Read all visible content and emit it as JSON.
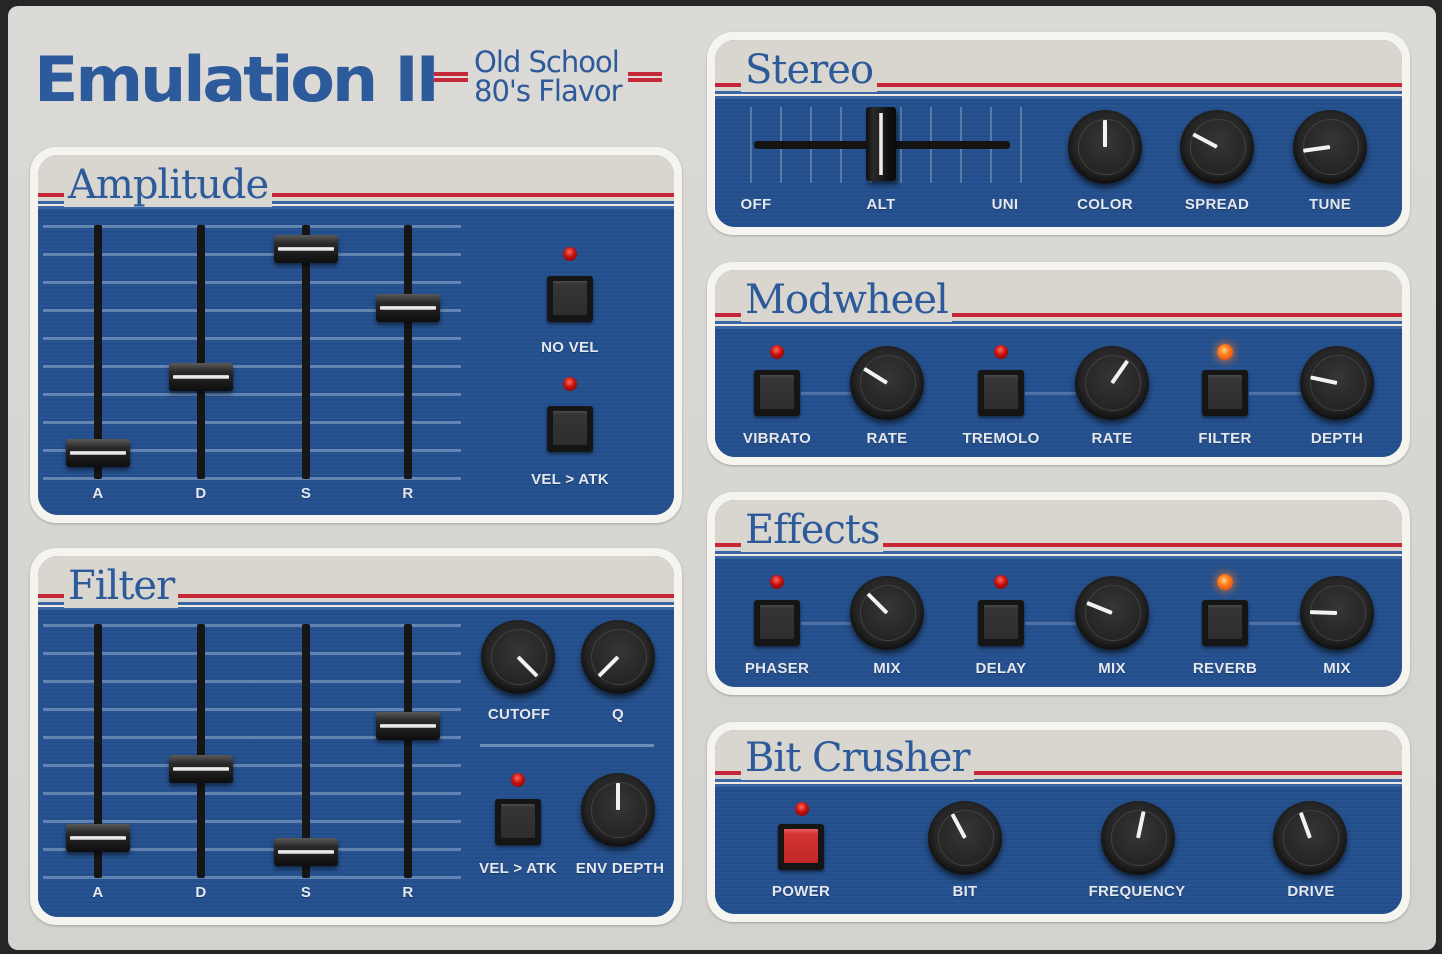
{
  "app": {
    "title": "Emulation II",
    "tagline_line1": "Old School",
    "tagline_line2": "80's Flavor"
  },
  "colors": {
    "panel_blue": "#24508e",
    "accent_red": "#c6283a",
    "title_blue": "#2c5a9a",
    "led_off": "#c2100c",
    "led_on": "#ff7a1a"
  },
  "amplitude": {
    "title": "Amplitude",
    "sliders": [
      {
        "label": "A",
        "value": 0.06
      },
      {
        "label": "D",
        "value": 0.39
      },
      {
        "label": "S",
        "value": 0.95
      },
      {
        "label": "R",
        "value": 0.69
      }
    ],
    "buttons": [
      {
        "label": "NO VEL",
        "led_on": false
      },
      {
        "label": "VEL > ATK",
        "led_on": false
      }
    ]
  },
  "filter": {
    "title": "Filter",
    "sliders": [
      {
        "label": "A",
        "value": 0.12
      },
      {
        "label": "D",
        "value": 0.42
      },
      {
        "label": "S",
        "value": 0.06
      },
      {
        "label": "R",
        "value": 0.61
      }
    ],
    "knobs": [
      {
        "label": "CUTOFF",
        "angle": 135
      },
      {
        "label": "Q",
        "angle": -135
      },
      {
        "label": "ENV DEPTH",
        "angle": 0
      }
    ],
    "button": {
      "label": "VEL > ATK",
      "led_on": false
    }
  },
  "stereo": {
    "title": "Stereo",
    "mode_switch": {
      "options": [
        "OFF",
        "ALT",
        "UNI"
      ],
      "selected": "ALT"
    },
    "knobs": [
      {
        "label": "COLOR",
        "angle": 0
      },
      {
        "label": "SPREAD",
        "angle": -62
      },
      {
        "label": "TUNE",
        "angle": -98
      }
    ]
  },
  "modwheel": {
    "title": "Modwheel",
    "items": [
      {
        "type": "button",
        "label": "VIBRATO",
        "led_on": false
      },
      {
        "type": "knob",
        "label": "RATE",
        "angle": -58
      },
      {
        "type": "button",
        "label": "TREMOLO",
        "led_on": false
      },
      {
        "type": "knob",
        "label": "RATE",
        "angle": 35
      },
      {
        "type": "button",
        "label": "FILTER",
        "led_on": true
      },
      {
        "type": "knob",
        "label": "DEPTH",
        "angle": -78
      }
    ]
  },
  "effects": {
    "title": "Effects",
    "items": [
      {
        "type": "button",
        "label": "PHASER",
        "led_on": false
      },
      {
        "type": "knob",
        "label": "MIX",
        "angle": -45
      },
      {
        "type": "button",
        "label": "DELAY",
        "led_on": false
      },
      {
        "type": "knob",
        "label": "MIX",
        "angle": -68
      },
      {
        "type": "button",
        "label": "REVERB",
        "led_on": true
      },
      {
        "type": "knob",
        "label": "MIX",
        "angle": -88
      }
    ]
  },
  "bitcrusher": {
    "title": "Bit Crusher",
    "power": {
      "label": "POWER",
      "active": true,
      "led_on": false
    },
    "knobs": [
      {
        "label": "BIT",
        "angle": -28
      },
      {
        "label": "FREQUENCY",
        "angle": 12
      },
      {
        "label": "DRIVE",
        "angle": -20
      }
    ]
  }
}
